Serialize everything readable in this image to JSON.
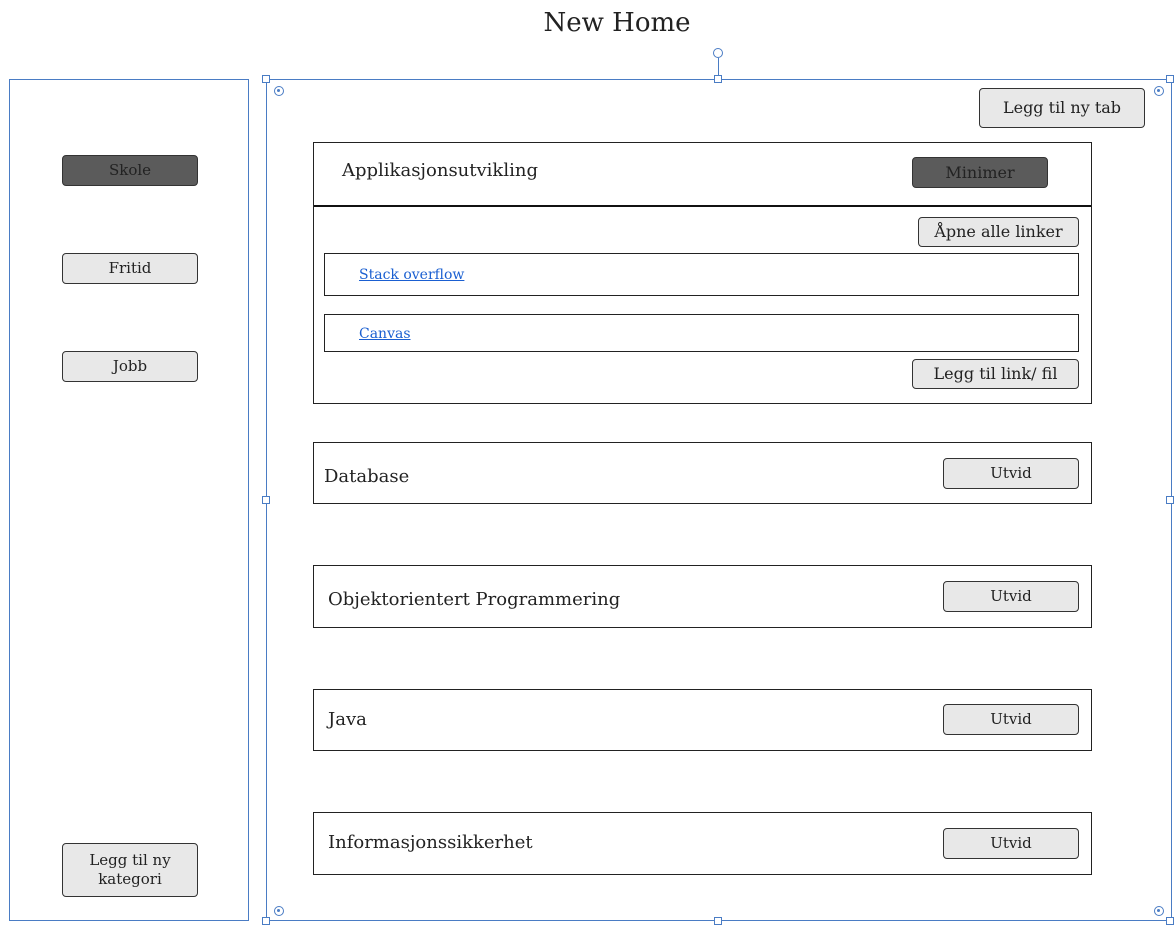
{
  "page": {
    "title": "New Home"
  },
  "sidebar": {
    "categories": [
      {
        "label": "Skole",
        "selected": true
      },
      {
        "label": "Fritid",
        "selected": false
      },
      {
        "label": "Jobb",
        "selected": false
      }
    ],
    "add_category_label": "Legg til ny kategori"
  },
  "main": {
    "add_tab_label": "Legg til ny tab",
    "expanded_tab": {
      "title": "Applikasjonsutvikling",
      "minimize_label": "Minimer",
      "open_all_label": "Åpne alle linker",
      "links": [
        "Stack overflow",
        "Canvas"
      ],
      "add_link_label": "Legg til link/ fil"
    },
    "collapsed_tabs": [
      {
        "title": "Database",
        "expand_label": "Utvid"
      },
      {
        "title": "Objektorientert Programmering",
        "expand_label": "Utvid"
      },
      {
        "title": "Java",
        "expand_label": "Utvid"
      },
      {
        "title": "Informasjonssikkerhet",
        "expand_label": "Utvid"
      }
    ]
  },
  "colors": {
    "selection": "#4a7cc4",
    "selected_button": "#5b5b5b",
    "button": "#e8e8e8",
    "link": "#1a5fd1"
  }
}
